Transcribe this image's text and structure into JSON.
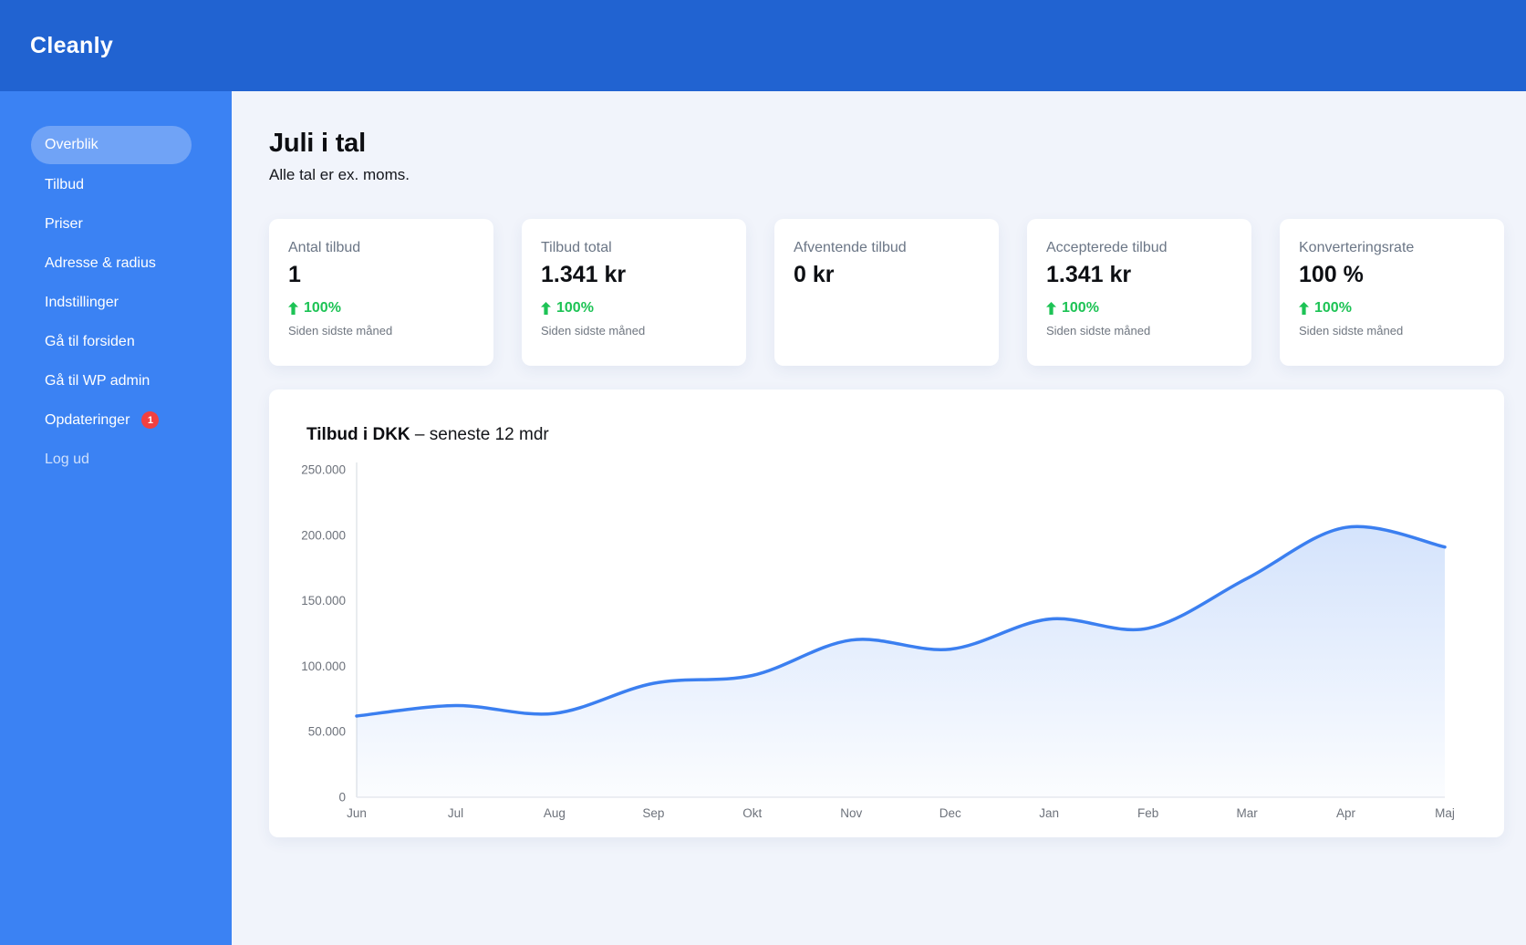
{
  "header": {
    "logo": "Cleanly"
  },
  "sidebar": {
    "items": [
      {
        "label": "Overblik",
        "active": true
      },
      {
        "label": "Tilbud"
      },
      {
        "label": "Priser"
      },
      {
        "label": "Adresse & radius"
      },
      {
        "label": "Indstillinger"
      },
      {
        "label": "Gå til forsiden"
      },
      {
        "label": "Gå til WP admin"
      },
      {
        "label": "Opdateringer",
        "badge": "1"
      },
      {
        "label": "Log ud",
        "muted": true
      }
    ]
  },
  "main": {
    "title": "Juli i tal",
    "subtitle": "Alle tal er ex. moms.",
    "cards": [
      {
        "label": "Antal tilbud",
        "value": "1",
        "trend": "100%",
        "trend_note": "Siden sidste måned"
      },
      {
        "label": "Tilbud total",
        "value": "1.341 kr",
        "trend": "100%",
        "trend_note": "Siden sidste måned"
      },
      {
        "label": "Afventende tilbud",
        "value": "0 kr"
      },
      {
        "label": "Accepterede tilbud",
        "value": "1.341 kr",
        "trend": "100%",
        "trend_note": "Siden sidste måned"
      },
      {
        "label": "Konverteringsrate",
        "value": "100 %",
        "trend": "100%",
        "trend_note": "Siden sidste måned"
      }
    ]
  },
  "chart": {
    "title_bold": "Tilbud i DKK",
    "title_rest": "– seneste 12 mdr"
  },
  "chart_data": {
    "type": "line",
    "title": "Tilbud i DKK – seneste 12 mdr",
    "x": [
      "Jun",
      "Jul",
      "Aug",
      "Sep",
      "Okt",
      "Nov",
      "Dec",
      "Jan",
      "Feb",
      "Mar",
      "Apr",
      "Maj"
    ],
    "values": [
      62000,
      70000,
      64000,
      87000,
      93000,
      120000,
      113000,
      136000,
      129000,
      167000,
      206000,
      191000
    ],
    "ylim": [
      0,
      250000
    ],
    "y_ticks": [
      0,
      50000,
      100000,
      150000,
      200000,
      250000
    ],
    "y_tick_labels": [
      "0",
      "50.000",
      "100.000",
      "150.000",
      "200.000",
      "250.000"
    ],
    "grid": false,
    "legend": false,
    "line_color": "#3b7ff0",
    "area": true
  },
  "colors": {
    "header_blue": "#2163d1",
    "sidebar_blue": "#3b82f3",
    "bg_main": "#f1f4fb",
    "trend_green": "#1dc355",
    "badge_red": "#f24040",
    "line_blue": "#3b7ff0"
  }
}
